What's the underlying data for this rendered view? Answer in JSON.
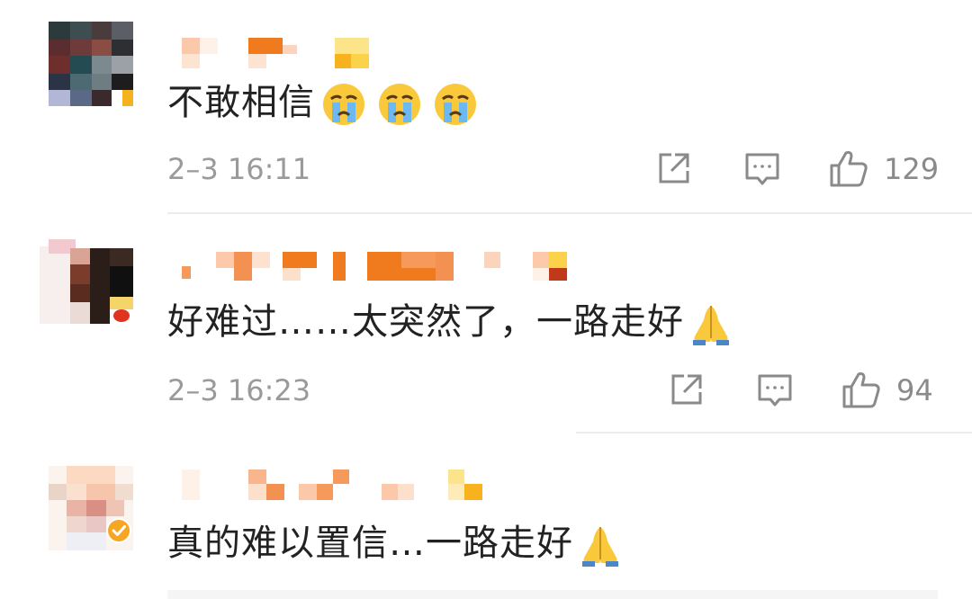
{
  "comments": [
    {
      "text": "不敢相信",
      "emoji": [
        "crying-face",
        "crying-face",
        "crying-face"
      ],
      "time": "2–3 16:11",
      "likes": "129"
    },
    {
      "text": "好难过……太突然了，一路走好",
      "emoji": [
        "folded-hands"
      ],
      "time": "2–3 16:23",
      "likes": "94"
    },
    {
      "text": "真的难以置信…一路走好",
      "emoji": [
        "folded-hands"
      ],
      "verified": true
    }
  ],
  "icons": [
    "share-icon",
    "reply-icon",
    "like-icon"
  ],
  "colors": {
    "text": "#222222",
    "meta": "#9a9a9a",
    "divider": "#ececec",
    "verified": "#f5a623"
  }
}
